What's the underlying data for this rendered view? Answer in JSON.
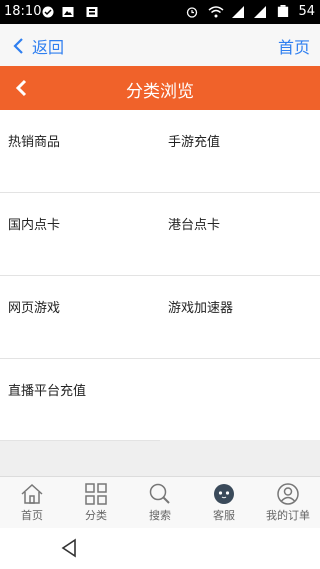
{
  "status_bar": {
    "time": "18:10",
    "battery": "54"
  },
  "app_nav": {
    "back_label": "返回",
    "home_label": "首页"
  },
  "header": {
    "title": "分类浏览"
  },
  "categories": [
    [
      "热销商品",
      "手游充值"
    ],
    [
      "国内点卡",
      "港台点卡"
    ],
    [
      "网页游戏",
      "游戏加速器"
    ],
    [
      "直播平台充值",
      ""
    ]
  ],
  "tabbar": {
    "home": "首页",
    "category": "分类",
    "search": "搜索",
    "service": "客服",
    "orders": "我的订单"
  },
  "colors": {
    "accent": "#f0622a",
    "link": "#2f7ff0"
  }
}
